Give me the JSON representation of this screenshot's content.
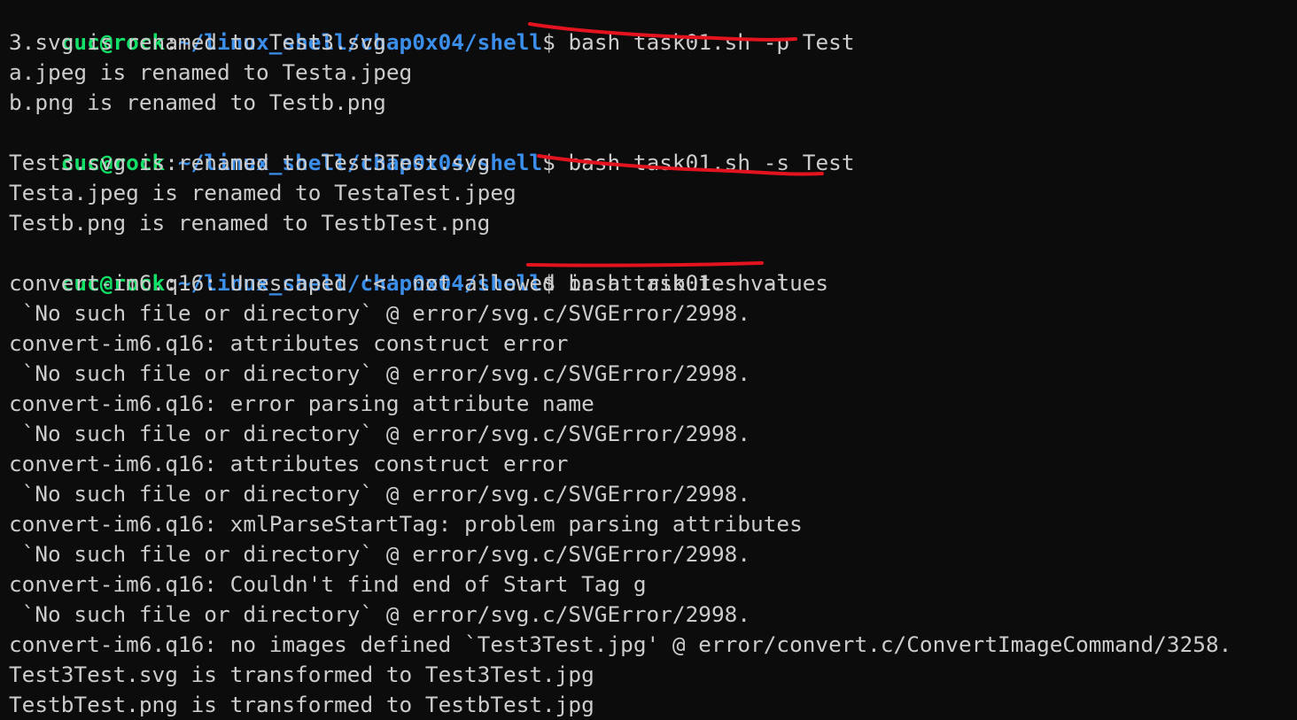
{
  "terminal": {
    "lines": [
      {
        "type": "prompt",
        "user_host": "cuc@rock",
        "colon": ":",
        "path": "~/linux_shell/chap0x04/shell",
        "dollar": "$",
        "command": "bash task01.sh -p Test"
      },
      {
        "type": "output",
        "text": "3.svg is renamed to Test3.svg"
      },
      {
        "type": "output",
        "text": "a.jpeg is renamed to Testa.jpeg"
      },
      {
        "type": "output",
        "text": "b.png is renamed to Testb.png"
      },
      {
        "type": "prompt",
        "user_host": "cuc@rock",
        "colon": ":",
        "path": "~/linux_shell/chap0x04/shell",
        "dollar": "$",
        "command": "bash task01.sh -s Test"
      },
      {
        "type": "output",
        "text": "Test3.svg is renamed to Test3Test.svg"
      },
      {
        "type": "output",
        "text": "Testa.jpeg is renamed to TestaTest.jpeg"
      },
      {
        "type": "output",
        "text": "Testb.png is renamed to TestbTest.png"
      },
      {
        "type": "prompt",
        "user_host": "cuc@rock",
        "colon": ":",
        "path": "~/linux_shell/chap0x04/shell",
        "dollar": "$",
        "command": "bash task01.sh -t"
      },
      {
        "type": "output",
        "text": "convert-im6.q16: Unescaped '<' not allowed in attributes values"
      },
      {
        "type": "output",
        "text": " `No such file or directory` @ error/svg.c/SVGError/2998."
      },
      {
        "type": "output",
        "text": "convert-im6.q16: attributes construct error"
      },
      {
        "type": "output",
        "text": " `No such file or directory` @ error/svg.c/SVGError/2998."
      },
      {
        "type": "output",
        "text": "convert-im6.q16: error parsing attribute name"
      },
      {
        "type": "output",
        "text": " `No such file or directory` @ error/svg.c/SVGError/2998."
      },
      {
        "type": "output",
        "text": "convert-im6.q16: attributes construct error"
      },
      {
        "type": "output",
        "text": " `No such file or directory` @ error/svg.c/SVGError/2998."
      },
      {
        "type": "output",
        "text": "convert-im6.q16: xmlParseStartTag: problem parsing attributes"
      },
      {
        "type": "output",
        "text": " `No such file or directory` @ error/svg.c/SVGError/2998."
      },
      {
        "type": "output",
        "text": "convert-im6.q16: Couldn't find end of Start Tag g"
      },
      {
        "type": "output",
        "text": " `No such file or directory` @ error/svg.c/SVGError/2998."
      },
      {
        "type": "output",
        "text": "convert-im6.q16: no images defined `Test3Test.jpg' @ error/convert.c/ConvertImageCommand/3258."
      },
      {
        "type": "output",
        "text": "Test3Test.svg is transformed to Test3Test.jpg"
      },
      {
        "type": "output",
        "text": "TestbTest.png is transformed to TestbTest.jpg"
      }
    ]
  },
  "colors": {
    "background": "#0c0c0c",
    "foreground": "#cccccc",
    "prompt_user": "#13e068",
    "prompt_path": "#3b8eea",
    "annotation_underline": "#e3131f"
  }
}
